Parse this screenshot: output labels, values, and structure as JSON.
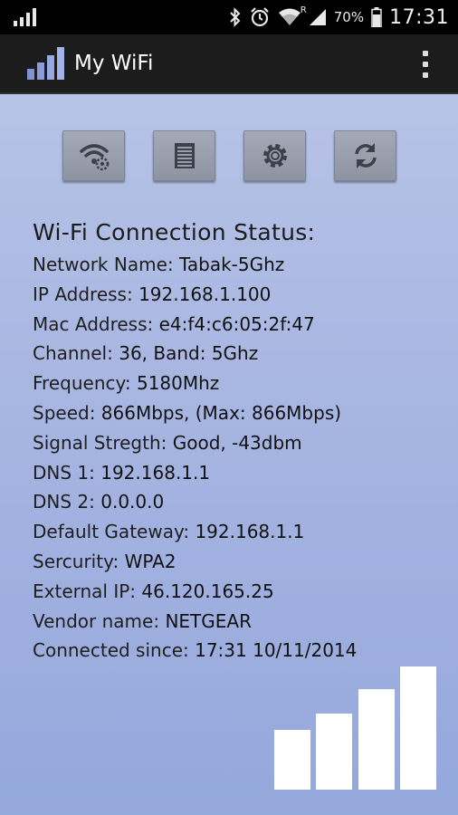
{
  "status_bar": {
    "battery_percent": "70%",
    "time": "17:31",
    "roaming_label": "R",
    "icons": [
      "signal-bars-icon",
      "bluetooth-icon",
      "alarm-clock-icon",
      "wifi-icon",
      "cell-signal-icon",
      "battery-icon"
    ]
  },
  "app_bar": {
    "title": "My WiFi",
    "icons": [
      "app-logo-signal-icon",
      "overflow-menu-icon"
    ]
  },
  "toolbar": {
    "buttons": [
      {
        "name": "wifi-settings",
        "icon": "wifi-gear-icon"
      },
      {
        "name": "log",
        "icon": "list-icon"
      },
      {
        "name": "settings",
        "icon": "gear-icon"
      },
      {
        "name": "refresh",
        "icon": "refresh-icon"
      }
    ]
  },
  "status": {
    "title": "Wi-Fi Connection Status:",
    "rows": [
      {
        "label": "Network Name: ",
        "value": "Tabak-5Ghz"
      },
      {
        "label": "IP Address: ",
        "value": "192.168.1.100"
      },
      {
        "label": "Mac Address: ",
        "value": "e4:f4:c6:05:2f:47"
      },
      {
        "label": "Channel: ",
        "value": "36, Band: 5Ghz"
      },
      {
        "label": "Frequency: ",
        "value": "5180Mhz"
      },
      {
        "label": "Speed: ",
        "value": "866Mbps, (Max: 866Mbps)"
      },
      {
        "label": "Signal Stregth: ",
        "value": "Good, -43dbm"
      },
      {
        "label": "DNS 1: ",
        "value": "192.168.1.1"
      },
      {
        "label": "DNS 2: ",
        "value": "0.0.0.0"
      },
      {
        "label": "Default Gateway: ",
        "value": "192.168.1.1"
      },
      {
        "label": "Sercurity: ",
        "value": "WPA2"
      },
      {
        "label": "External IP: ",
        "value": "46.120.165.25"
      },
      {
        "label": "Vendor name: ",
        "value": "NETGEAR"
      },
      {
        "label": "Connected since: ",
        "value": "17:31 10/11/2014"
      }
    ]
  },
  "signal_meter": {
    "bars_lit": 4,
    "bars_total": 4,
    "icon": "signal-strength-bars-icon"
  },
  "colors": {
    "background_top": "#b7c3e6",
    "background_bottom": "#95a8dc",
    "action_bar": "#1c1c1c",
    "button_gray": "#979daa",
    "signal_bars": "#ffffff"
  }
}
